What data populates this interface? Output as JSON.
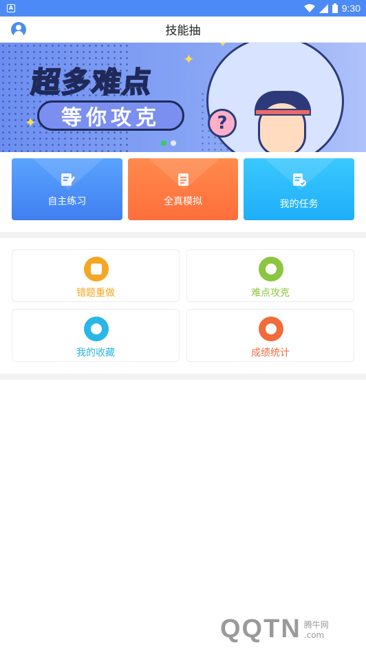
{
  "status_bar": {
    "time": "9:30",
    "app_icon": "A"
  },
  "header": {
    "title": "技能抽"
  },
  "banner": {
    "headline": "超多难点",
    "subline": "等你攻克",
    "bubble": "?"
  },
  "quick_actions": [
    {
      "label": "自主练习",
      "icon": "edit-note-icon"
    },
    {
      "label": "全真模拟",
      "icon": "scroll-document-icon"
    },
    {
      "label": "我的任务",
      "icon": "task-check-icon"
    }
  ],
  "tiles": [
    {
      "label": "错题重做",
      "icon": "wrong-answer-icon",
      "color": "#F5A623"
    },
    {
      "label": "难点攻克",
      "icon": "question-icon",
      "color": "#8CC63F"
    },
    {
      "label": "我的收藏",
      "icon": "star-favorite-icon",
      "color": "#29B6E8"
    },
    {
      "label": "成绩统计",
      "icon": "pie-chart-icon",
      "color": "#F26B3A"
    }
  ],
  "watermark": {
    "logo": "QQTN",
    "site": "腾牛网",
    "domain": ".com"
  },
  "colors": {
    "primary": "#4C8BF5",
    "orange": "#FF7A42",
    "cyan": "#2BB8FA"
  }
}
